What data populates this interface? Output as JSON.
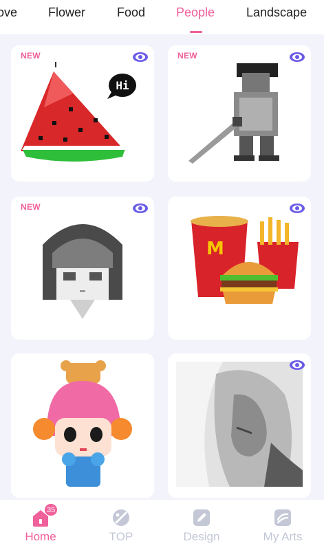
{
  "tabs": [
    {
      "label": "ove"
    },
    {
      "label": "Flower"
    },
    {
      "label": "Food"
    },
    {
      "label": "People",
      "active": true
    },
    {
      "label": "Landscape"
    }
  ],
  "cards": [
    {
      "badge": "NEW",
      "subject": "watermelon-slice",
      "speech_text": "Hi"
    },
    {
      "badge": "NEW",
      "subject": "armored-warrior"
    },
    {
      "badge": "NEW",
      "subject": "grey-haired-girl"
    },
    {
      "badge": "",
      "subject": "fast-food-meal"
    },
    {
      "badge": "",
      "subject": "pink-haired-girl-with-bears"
    },
    {
      "badge": "",
      "subject": "woman-portrait"
    }
  ],
  "bottom_nav": {
    "items": [
      {
        "label": "Home",
        "icon": "home-icon",
        "badge": "35",
        "active": true
      },
      {
        "label": "TOP",
        "icon": "palette-icon"
      },
      {
        "label": "Design",
        "icon": "pencil-icon"
      },
      {
        "label": "My Arts",
        "icon": "arts-icon"
      }
    ]
  },
  "colors": {
    "accent": "#f0609a",
    "eye": "#6b5ce7",
    "inactive": "#c3c7d6",
    "background": "#f3f4fb"
  }
}
